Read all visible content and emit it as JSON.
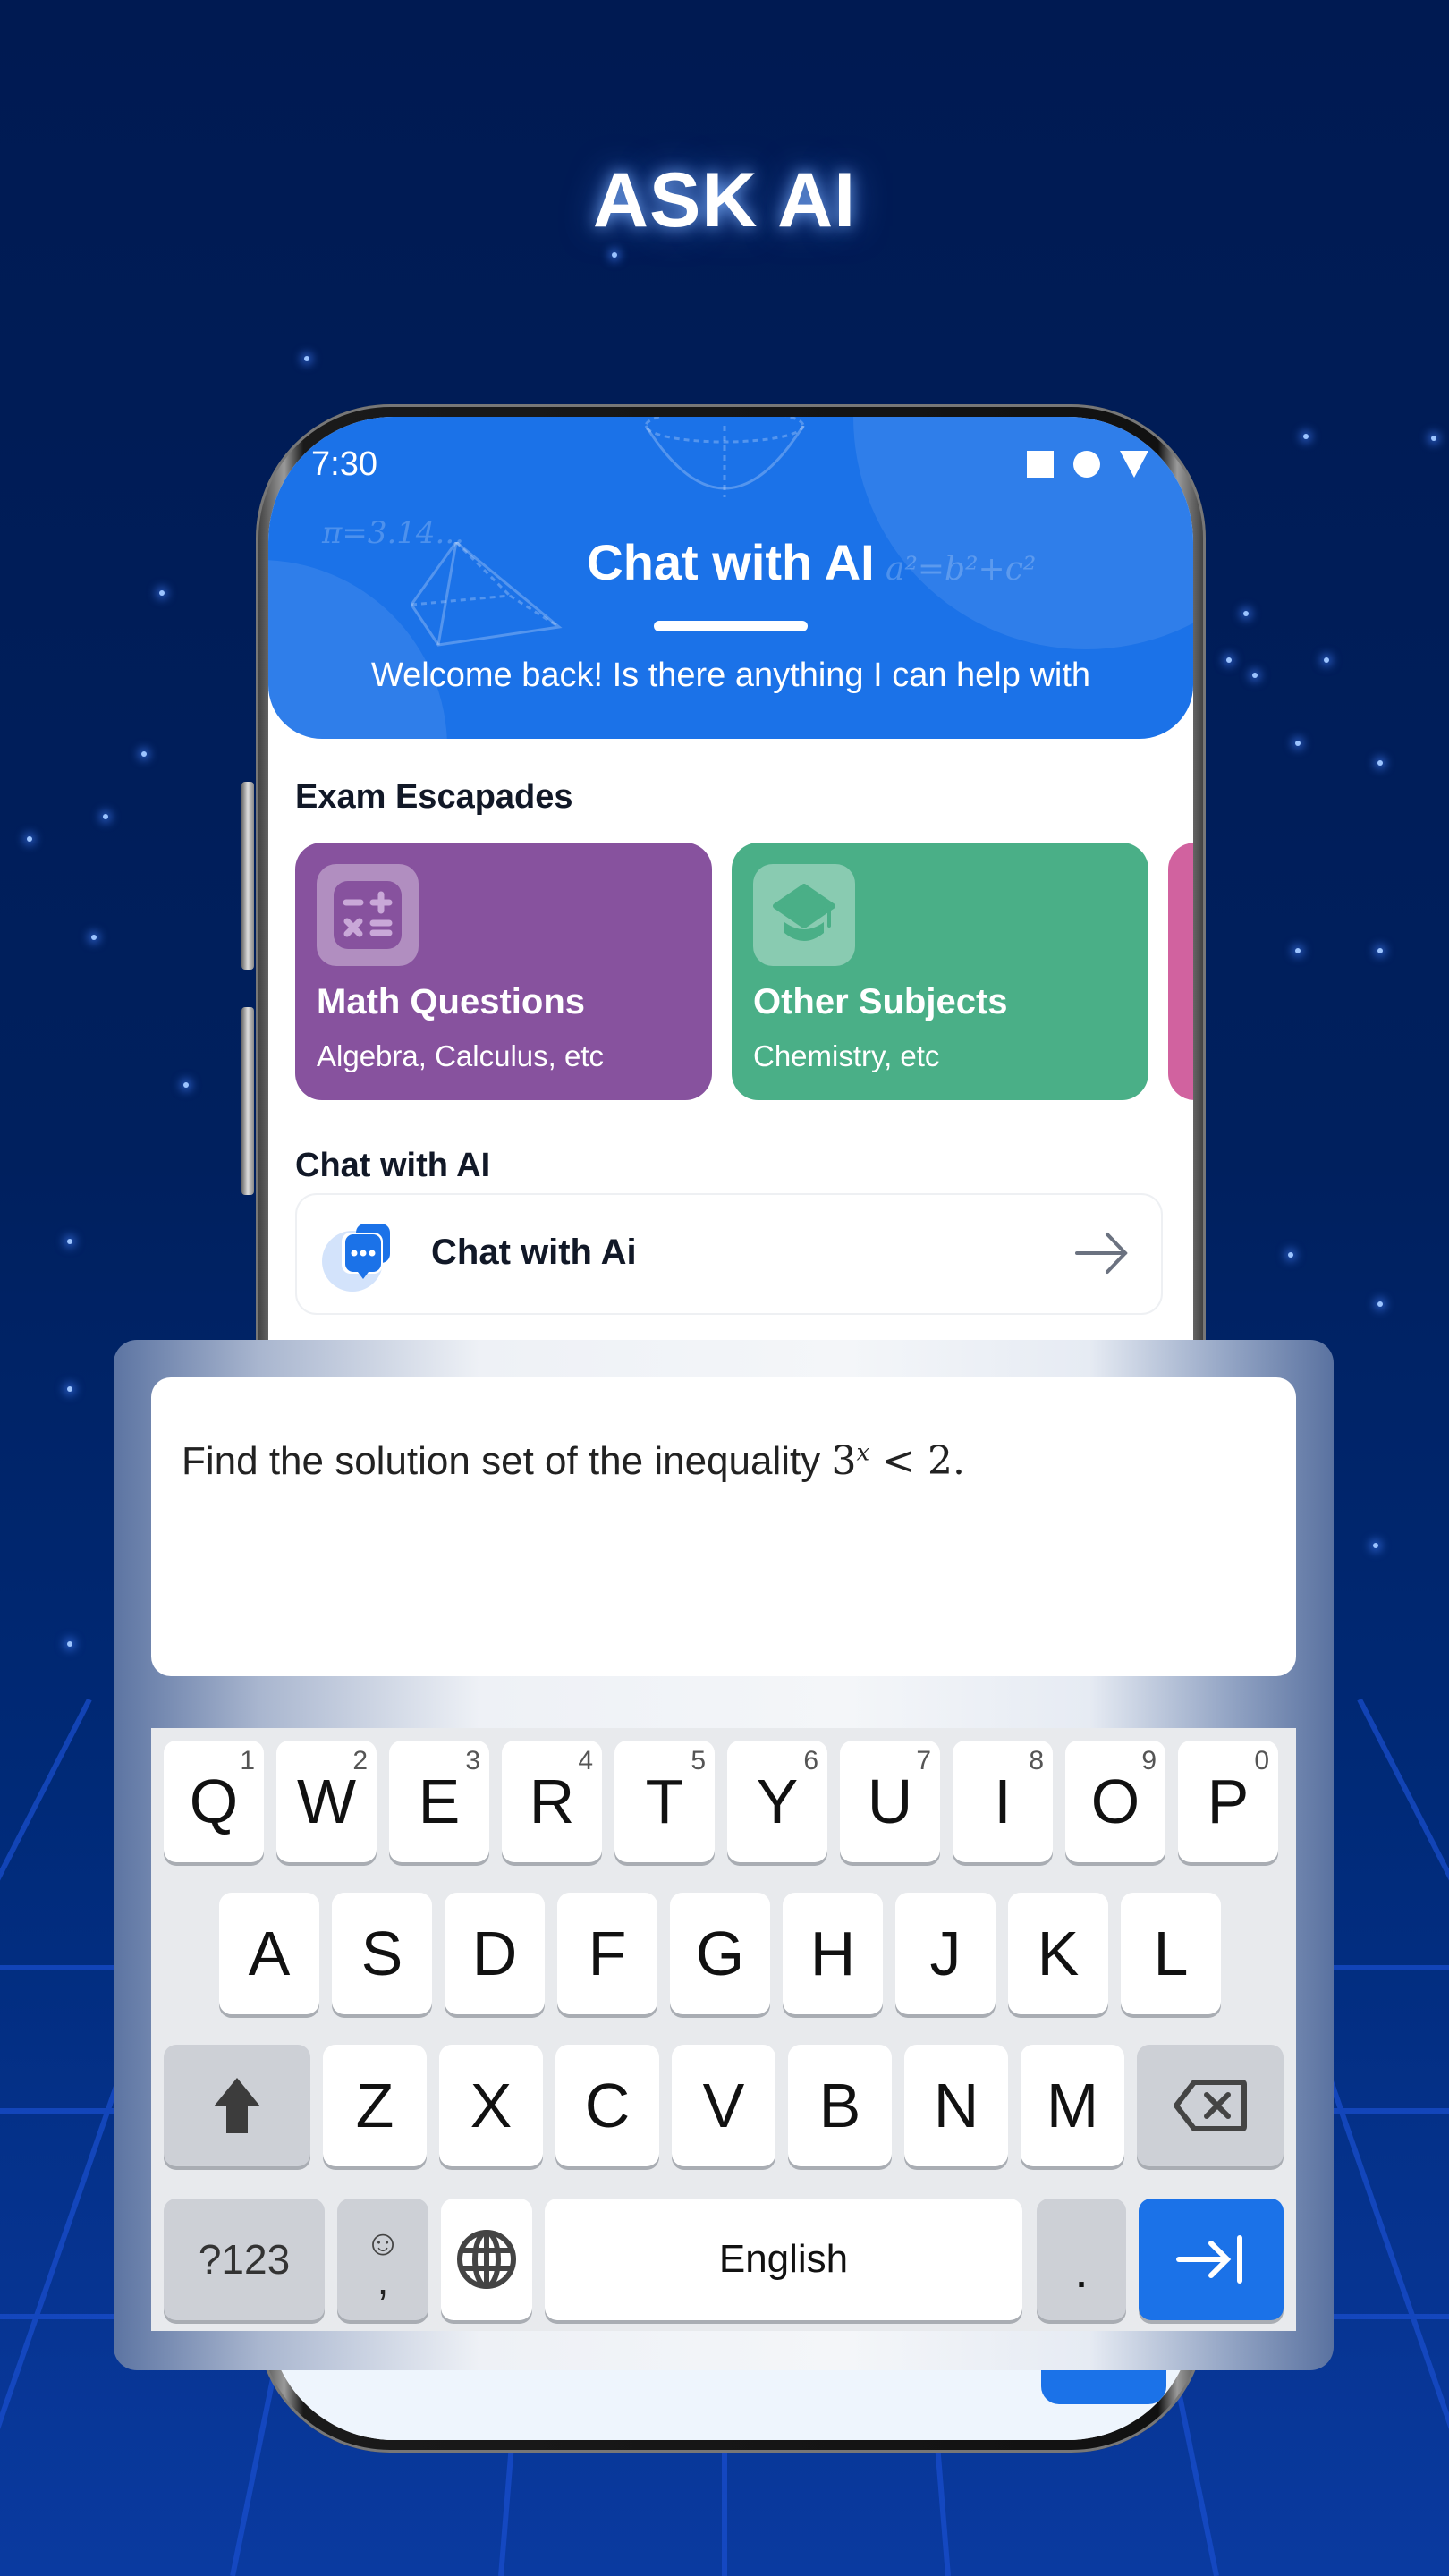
{
  "promo": {
    "headline": "ASK AI"
  },
  "status_bar": {
    "time": "7:30",
    "icons": [
      "square-icon",
      "circle-icon",
      "triangle-icon"
    ]
  },
  "header": {
    "title": "Chat with AI",
    "subtitle": "Welcome back! Is there anything I can help with",
    "decorations": [
      "π=3.14...",
      "a²=b²+c²"
    ],
    "color": "#1b72e8"
  },
  "exam_section": {
    "title": "Exam Escapades",
    "cards": [
      {
        "title": "Math Questions",
        "subtitle": "Algebra, Calculus, etc",
        "icon": "calculator-icon",
        "color": "#87529e"
      },
      {
        "title": "Other Subjects",
        "subtitle": "Chemistry, etc",
        "icon": "graduation-cap-icon",
        "color": "#4aaf87"
      },
      {
        "title": "",
        "subtitle": "",
        "icon": "",
        "color": "#d1629f"
      }
    ]
  },
  "chat_section": {
    "title": "Chat with AI",
    "item_label": "Chat with Ai",
    "item_icon": "chat-bubbles-icon",
    "arrow_icon": "arrow-right-icon"
  },
  "input": {
    "text_prefix": "Find the solution set of the inequality ",
    "math_base": "3",
    "math_exponent": "x",
    "math_rest": " < 2."
  },
  "keyboard": {
    "row1": [
      {
        "key": "Q",
        "hint": "1"
      },
      {
        "key": "W",
        "hint": "2"
      },
      {
        "key": "E",
        "hint": "3"
      },
      {
        "key": "R",
        "hint": "4"
      },
      {
        "key": "T",
        "hint": "5"
      },
      {
        "key": "Y",
        "hint": "6"
      },
      {
        "key": "U",
        "hint": "7"
      },
      {
        "key": "I",
        "hint": "8"
      },
      {
        "key": "O",
        "hint": "9"
      },
      {
        "key": "P",
        "hint": "0"
      }
    ],
    "row2": [
      "A",
      "S",
      "D",
      "F",
      "G",
      "H",
      "J",
      "K",
      "L"
    ],
    "row3": [
      "Z",
      "X",
      "C",
      "V",
      "B",
      "N",
      "M"
    ],
    "shift_icon": "shift-arrow-icon",
    "backspace_icon": "backspace-icon",
    "symbols_label": "?123",
    "emoji_label": "☺",
    "comma_label": ",",
    "globe_icon": "globe-icon",
    "space_label": "English",
    "period_label": ".",
    "enter_icon": "tab-arrow-icon",
    "accent_color": "#1b72e8"
  }
}
